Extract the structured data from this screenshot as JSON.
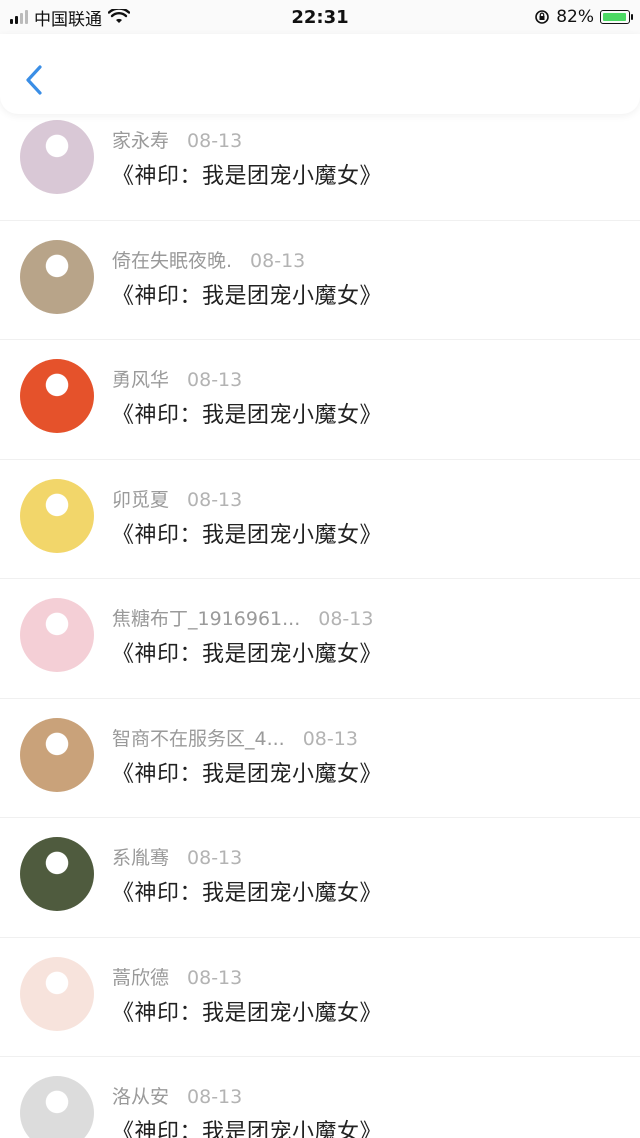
{
  "status_bar": {
    "carrier": "中国联通",
    "time": "22:31",
    "battery": "82%"
  },
  "items": [
    {
      "name": "家永寿",
      "date": "08-13",
      "title": "《神印：我是团宠小魔女》",
      "avatar_color": "#d9c8d6"
    },
    {
      "name": "倚在失眠夜晚.",
      "date": "08-13",
      "title": "《神印：我是团宠小魔女》",
      "avatar_color": "#b8a489"
    },
    {
      "name": "勇风华",
      "date": "08-13",
      "title": "《神印：我是团宠小魔女》",
      "avatar_color": "#e5522b"
    },
    {
      "name": "卯觅夏",
      "date": "08-13",
      "title": "《神印：我是团宠小魔女》",
      "avatar_color": "#f2d66a"
    },
    {
      "name": "焦糖布丁_1916961...",
      "date": "08-13",
      "title": "《神印：我是团宠小魔女》",
      "avatar_color": "#f4cfd6"
    },
    {
      "name": "智商不在服务区_4...",
      "date": "08-13",
      "title": "《神印：我是团宠小魔女》",
      "avatar_color": "#c9a27a"
    },
    {
      "name": "系胤骞",
      "date": "08-13",
      "title": "《神印：我是团宠小魔女》",
      "avatar_color": "#4f5b3e"
    },
    {
      "name": "蒿欣德",
      "date": "08-13",
      "title": "《神印：我是团宠小魔女》",
      "avatar_color": "#f7e3dc"
    },
    {
      "name": "洛从安",
      "date": "08-13",
      "title": "《神印：我是团宠小魔女》",
      "avatar_color": "#dcdcdc"
    }
  ]
}
